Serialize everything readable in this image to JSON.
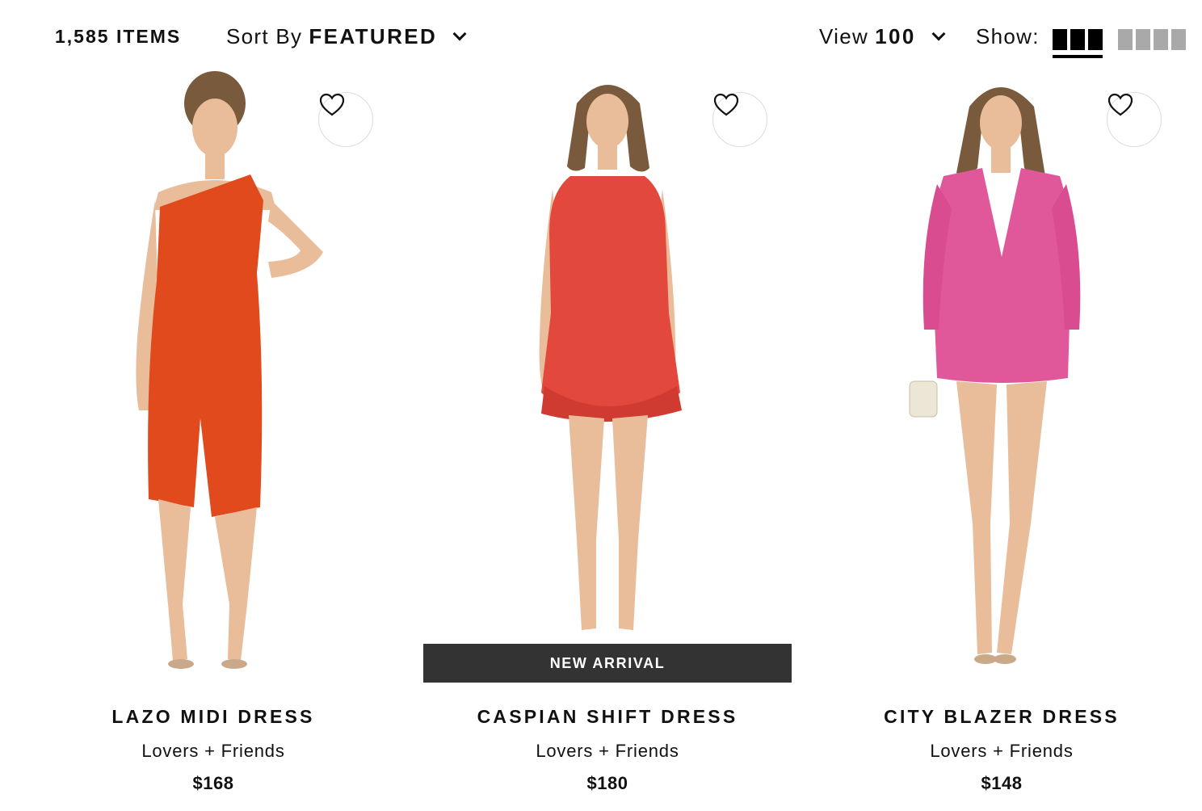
{
  "toolbar": {
    "item_count": "1,585 ITEMS",
    "sort_label": "Sort By",
    "sort_value": "FEATURED",
    "view_label": "View",
    "view_value": "100",
    "show_label": "Show:",
    "layout_options": [
      "3-column",
      "4-column"
    ],
    "layout_selected": "3-column"
  },
  "products": [
    {
      "name": "LAZO MIDI DRESS",
      "brand": "Lovers + Friends",
      "price": "$168",
      "dress_color": "#e04a1c",
      "badge": ""
    },
    {
      "name": "CASPIAN SHIFT DRESS",
      "brand": "Lovers + Friends",
      "price": "$180",
      "dress_color": "#e2483c",
      "badge": "NEW ARRIVAL"
    },
    {
      "name": "CITY BLAZER DRESS",
      "brand": "Lovers + Friends",
      "price": "$148",
      "dress_color": "#e0579a",
      "badge": ""
    }
  ],
  "colors": {
    "badge_bg": "#333333",
    "grid_active": "#000000",
    "grid_inactive": "#a9a9a9",
    "skin": "#e9bc9a",
    "hair": "#7a5a3c"
  }
}
